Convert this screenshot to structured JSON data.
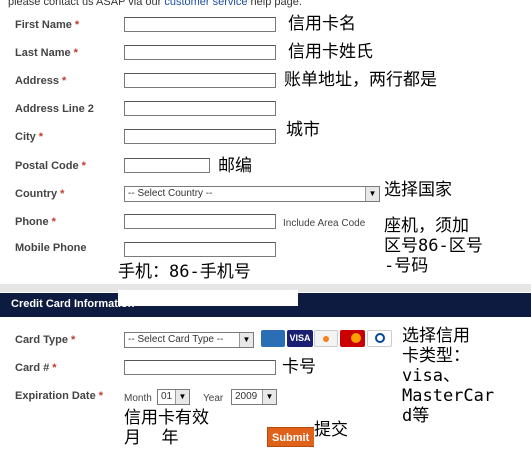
{
  "header_note": {
    "prefix": "please contact us ASAP via our",
    "link": "customer service",
    "suffix": "help page."
  },
  "fields": {
    "first_name": "First Name",
    "last_name": "Last Name",
    "address": "Address",
    "address2": "Address Line 2",
    "city": "City",
    "postal_code": "Postal Code",
    "country": "Country",
    "phone": "Phone",
    "mobile": "Mobile Phone",
    "required_mark": "*"
  },
  "country_select": {
    "value": "-- Select Country --"
  },
  "phone_hint": "Include Area Code",
  "credit_card": {
    "section_title": "Credit Card Information",
    "card_type_label": "Card Type",
    "card_type_value": "-- Select Card Type --",
    "card_number_label": "Card #",
    "expiration_label": "Expiration Date",
    "month_label": "Month",
    "month_value": "01",
    "year_label": "Year",
    "year_value": "2009",
    "logos": [
      "AMEX",
      "VISA",
      "DISCOVER",
      "MasterCard",
      "Diners Club"
    ]
  },
  "submit_label": "Submit",
  "annotations": {
    "first_name": "信用卡名",
    "last_name": "信用卡姓氏",
    "address": "账单地址，两行都是",
    "city": "城市",
    "postal_code": "邮编",
    "country": "选择国家",
    "phone": "座机，须加\n区号86-区号\n-号码",
    "mobile": "手机：86-手机号",
    "card_type": "选择信用\n卡类型：\nvisa、\nMasterCar\nd等",
    "card_number": "卡号",
    "expiration": "信用卡有效\n月  年",
    "submit": "提交"
  }
}
